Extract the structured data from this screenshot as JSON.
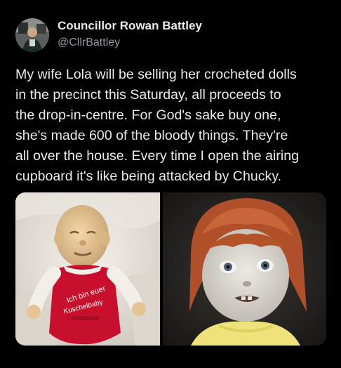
{
  "author": {
    "display_name": "Councillor Rowan Battley",
    "handle": "@CllrBattley"
  },
  "tweet": {
    "lines": [
      "My wife Lola will be selling her crocheted dolls",
      "in the precinct this Saturday, all proceeds to",
      "the drop-in-centre. For God's sake buy one,",
      "she's made 600 of the bloody things. They're",
      "all over the house. Every time I open the airing",
      "cupboard it's like being attacked by Chucky."
    ]
  },
  "media": {
    "photo_left": {
      "shirt_text_line1": "Ich bin euer",
      "shirt_text_line2": "Kuschelbaby"
    }
  },
  "colors": {
    "background": "#000000",
    "text_primary": "#e7e9ea",
    "text_secondary": "#8b98a5"
  }
}
